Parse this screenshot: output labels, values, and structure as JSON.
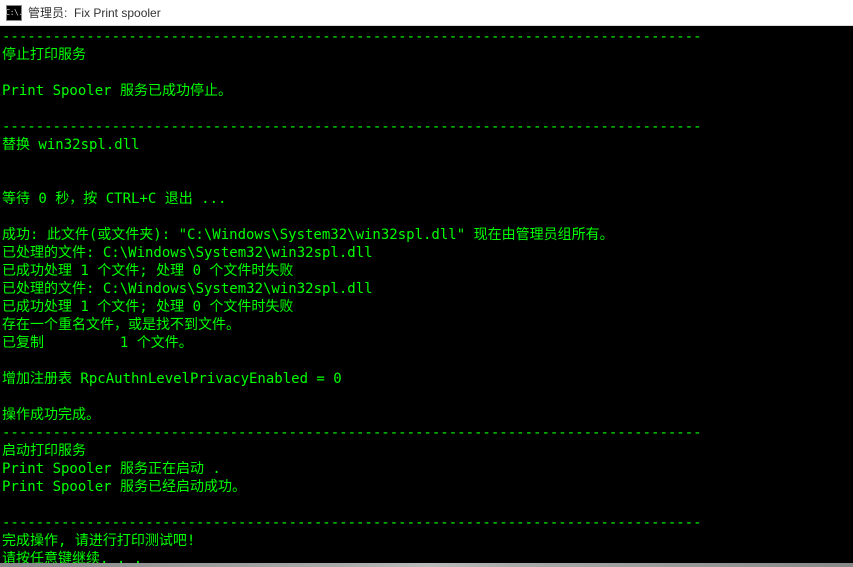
{
  "window": {
    "icon_text": "C:\\.",
    "title": "管理员:  Fix Print spooler"
  },
  "terminal": {
    "lines": [
      "-----------------------------------------------------------------------------------",
      "停止打印服务",
      "",
      "Print Spooler 服务已成功停止。",
      "",
      "-----------------------------------------------------------------------------------",
      "替换 win32spl.dll",
      "",
      "",
      "等待 0 秒，按 CTRL+C 退出 ...",
      "",
      "成功: 此文件(或文件夹): \"C:\\Windows\\System32\\win32spl.dll\" 现在由管理员组所有。",
      "已处理的文件: C:\\Windows\\System32\\win32spl.dll",
      "已成功处理 1 个文件; 处理 0 个文件时失败",
      "已处理的文件: C:\\Windows\\System32\\win32spl.dll",
      "已成功处理 1 个文件; 处理 0 个文件时失败",
      "存在一个重名文件，或是找不到文件。",
      "已复制         1 个文件。",
      "",
      "增加注册表 RpcAuthnLevelPrivacyEnabled = 0",
      "",
      "操作成功完成。",
      "-----------------------------------------------------------------------------------",
      "启动打印服务",
      "Print Spooler 服务正在启动 .",
      "Print Spooler 服务已经启动成功。",
      "",
      "-----------------------------------------------------------------------------------",
      "完成操作, 请进行打印测试吧!",
      "请按任意键继续. . ."
    ]
  }
}
